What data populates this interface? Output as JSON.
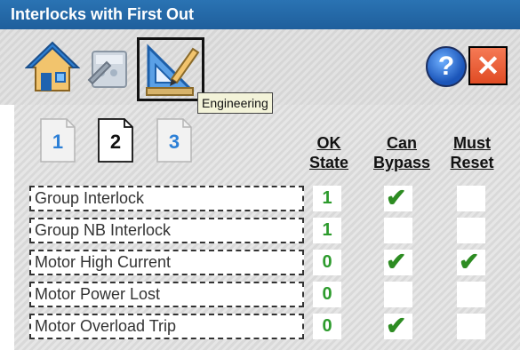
{
  "window": {
    "title": "Interlocks with First Out"
  },
  "toolbar": {
    "tools": [
      {
        "name": "home-icon"
      },
      {
        "name": "config-icon"
      },
      {
        "name": "engineering-icon"
      }
    ],
    "tooltip": "Engineering",
    "help_label": "?",
    "close_label": "✕"
  },
  "pages": {
    "items": [
      {
        "label": "1"
      },
      {
        "label": "2"
      },
      {
        "label": "3"
      }
    ],
    "selected": "2"
  },
  "columns": {
    "ok_line1": "OK",
    "ok_line2": "State",
    "bypass_line1": "Can",
    "bypass_line2": "Bypass",
    "reset_line1": "Must",
    "reset_line2": "Reset"
  },
  "rows": [
    {
      "label": "Group Interlock",
      "ok": "1",
      "can_bypass": true,
      "must_reset": false
    },
    {
      "label": "Group NB Interlock",
      "ok": "1",
      "can_bypass": false,
      "must_reset": false
    },
    {
      "label": "Motor High Current",
      "ok": "0",
      "can_bypass": true,
      "must_reset": true
    },
    {
      "label": "Motor Power Lost",
      "ok": "0",
      "can_bypass": false,
      "must_reset": false
    },
    {
      "label": "Motor Overload Trip",
      "ok": "0",
      "can_bypass": true,
      "must_reset": false
    }
  ],
  "colors": {
    "title_bar": "#1f5f9c",
    "ok_value": "#2d9b2d",
    "check": "#2d8c22",
    "close_button": "#e04b24",
    "help_button": "#1b55b9"
  }
}
